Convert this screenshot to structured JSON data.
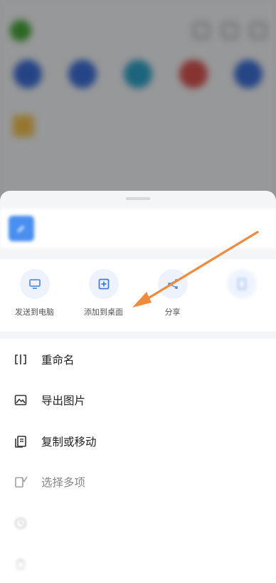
{
  "sheet": {
    "file_name": "",
    "file_meta": ""
  },
  "quick_actions": [
    {
      "label": "发送到电脑",
      "icon": "monitor-icon"
    },
    {
      "label": "添加到桌面",
      "icon": "add-square-icon"
    },
    {
      "label": "分享",
      "icon": "share-icon"
    },
    {
      "label": "",
      "icon": "document-icon"
    }
  ],
  "menu": [
    {
      "label": "重命名",
      "icon": "rename-icon"
    },
    {
      "label": "导出图片",
      "icon": "export-image-icon"
    },
    {
      "label": "复制或移动",
      "icon": "copy-move-icon"
    },
    {
      "label": "选择多项",
      "icon": "multi-select-icon"
    },
    {
      "label": "",
      "icon": "history-icon"
    },
    {
      "label": "",
      "icon": "delete-icon"
    }
  ],
  "colors": {
    "accent": "#4a8ff0",
    "arrow": "#f08a3c"
  }
}
